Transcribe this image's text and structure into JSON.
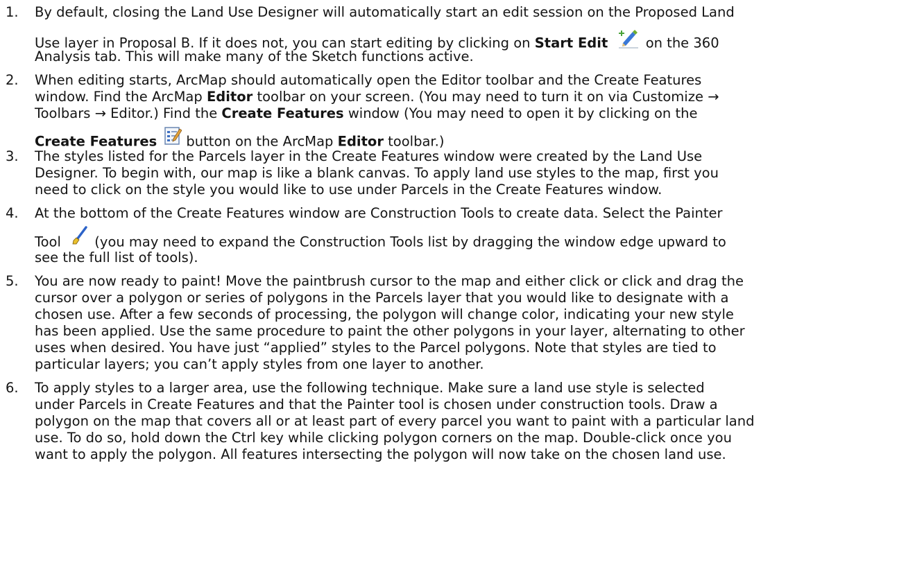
{
  "items": [
    {
      "num": "1.",
      "l1": "By default, closing the Land Use Designer will automatically start an edit session on the Proposed Land",
      "l2a": "Use layer in Proposal B.  If it does not, you can start editing by clicking on ",
      "l2b": "Start Edit",
      "l2c": " on the 360",
      "l3": "Analysis tab. This will make many of the Sketch functions active.",
      "icon_label": "Start Edit",
      "icon": "start-edit-icon"
    },
    {
      "num": "2.",
      "l1": "When editing starts, ArcMap should automatically open the Editor toolbar and the Create Features",
      "l2a": "window. Find the ArcMap ",
      "l2b": "Editor",
      "l2c": " toolbar on your screen.  (You may need to turn it on via Customize →",
      "l3a": "Toolbars → Editor.)  Find the ",
      "l3b": "Create Features",
      "l3c": " window (You may need to open it by clicking on the",
      "l4a": "Create Features",
      "l4b": "button on the ArcMap ",
      "l4c": "Editor",
      "l4d": " toolbar.)",
      "icon": "create-features-icon"
    },
    {
      "num": "3.",
      "l1": "The styles listed for the Parcels layer in the Create Features window were created by the Land Use",
      "l2": "Designer. To begin with, our map is like a blank canvas. To apply land use styles to the map, first you",
      "l3": "need to click on the style you would like to use under Parcels in the Create Features window."
    },
    {
      "num": "4.",
      "l1": "At the bottom of the Create Features window are Construction Tools to create data. Select the Painter",
      "l2a": "Tool",
      "l2b": " (you may need to expand the Construction Tools list by dragging the window edge upward to",
      "l3": "see the full list of tools).",
      "icon": "painter-tool-icon"
    },
    {
      "num": "5.",
      "lines": [
        "You are now ready to paint!  Move the paintbrush cursor to the map and either click or click and drag the",
        "cursor over a polygon or series of polygons in the Parcels layer that you would like to designate with a",
        "chosen use.  After a few seconds of processing, the polygon will change color, indicating your new style",
        "has been applied.  Use the same procedure to paint the other polygons in your layer, alternating to other",
        "uses when desired. You have just “applied” styles to the Parcel polygons.  Note that styles are tied to",
        "particular layers; you can’t apply styles from one layer to another."
      ]
    },
    {
      "num": "6.",
      "lines": [
        "To apply styles to a larger area, use the following technique.  Make sure a land use style is selected",
        "under Parcels in Create Features and that the Painter tool is chosen under construction tools. Draw a",
        "polygon on the map that covers all or at least part of every parcel you want to paint with a particular land",
        "use. To do so, hold down the Ctrl key while clicking polygon corners on the map. Double-click once you",
        "want to apply the polygon. All features intersecting the polygon will now take on the chosen land use."
      ]
    }
  ]
}
